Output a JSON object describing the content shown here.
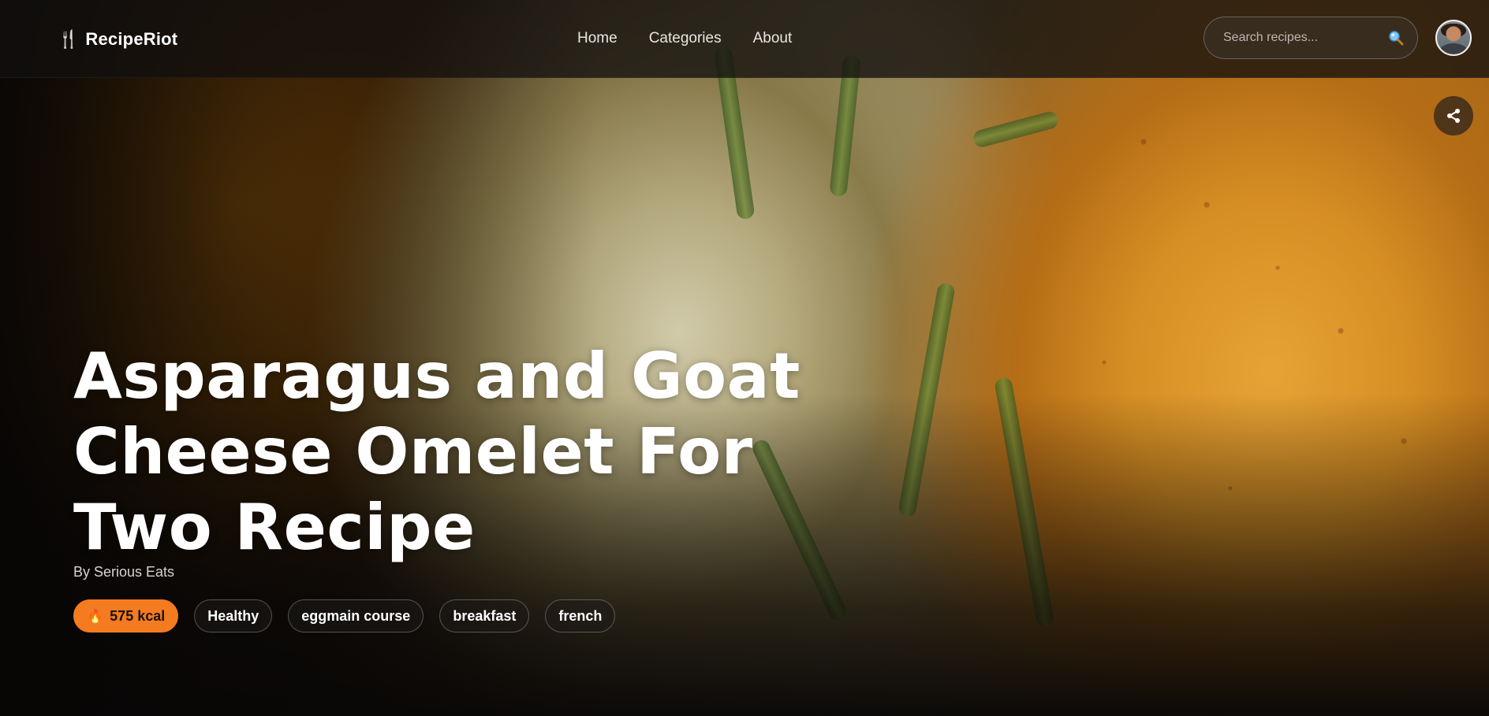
{
  "brand": {
    "name": "RecipeRiot",
    "icon": "fork-knife-icon",
    "accent_color": "#f47b20"
  },
  "nav": {
    "links": [
      "Home",
      "Categories",
      "About"
    ]
  },
  "search": {
    "placeholder": "Search recipes...",
    "value": "",
    "icon": "search-icon"
  },
  "user": {
    "avatar": "user-avatar"
  },
  "actions": {
    "share_icon": "share-icon"
  },
  "recipe": {
    "title": "Asparagus and Goat Cheese Omelet For Two Recipe",
    "author": "By Serious Eats",
    "calories": "575 kcal",
    "calories_icon": "fire-icon",
    "tags": [
      "Healthy",
      "eggmain course",
      "breakfast",
      "french"
    ]
  }
}
